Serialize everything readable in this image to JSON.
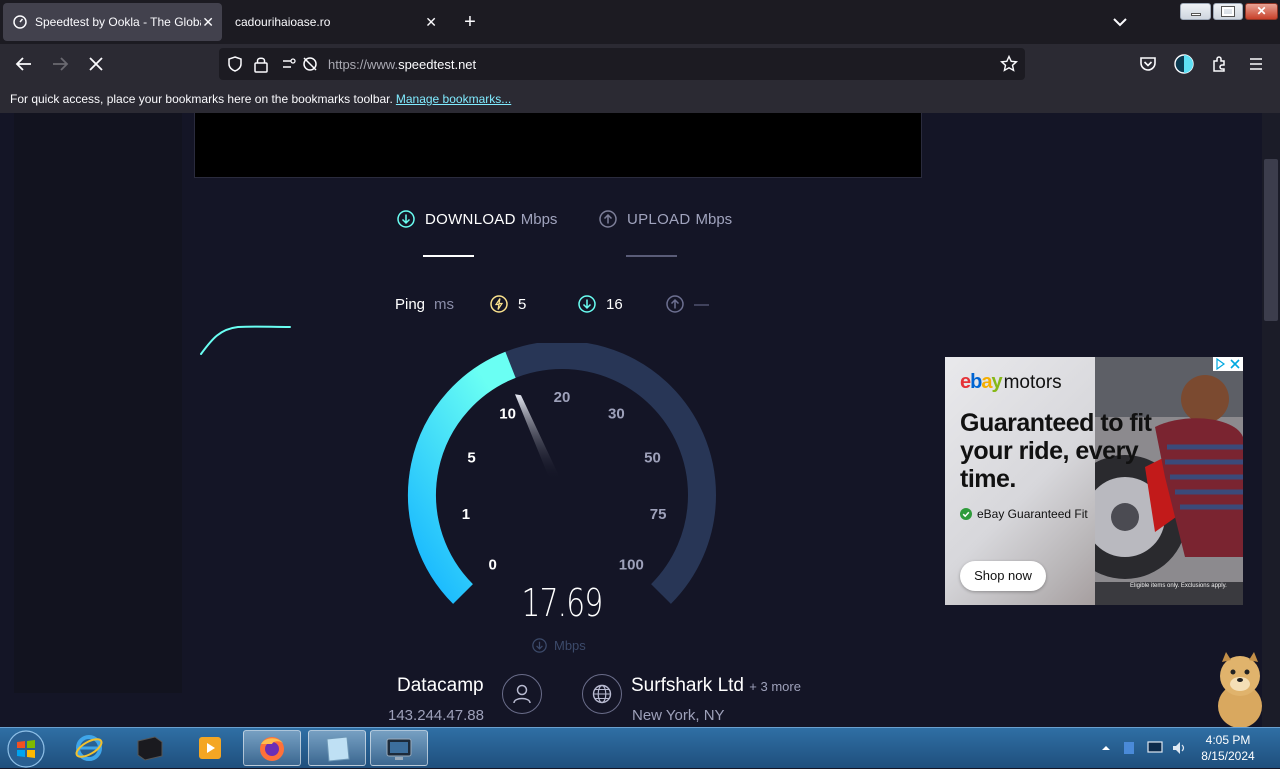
{
  "browser": {
    "tabs": [
      {
        "title": "Speedtest by Ookla - The Global",
        "active": true
      },
      {
        "title": "cadourihaioase.ro",
        "active": false
      }
    ],
    "url_scheme": "https://www.",
    "url_host": "speedtest.net",
    "bookmarks_message": "For quick access, place your bookmarks here on the bookmarks toolbar.",
    "bookmarks_link": "Manage bookmarks..."
  },
  "speedtest": {
    "download_label": "DOWNLOAD",
    "upload_label": "UPLOAD",
    "unit": "Mbps",
    "ping_label": "Ping",
    "ping_unit": "ms",
    "ping_idle": "5",
    "ping_download": "16",
    "ping_upload": "—",
    "gauge_ticks": [
      "0",
      "1",
      "5",
      "10",
      "20",
      "30",
      "50",
      "75",
      "100"
    ],
    "current_speed": "17.69",
    "speed_unit": "Mbps",
    "gauge_progress_percent": 42,
    "accent_download": "#6afff3",
    "accent_gauge_start": "#14b4ff",
    "provider_name": "Datacamp",
    "provider_ip": "143.244.47.88",
    "server_name": "Surfshark Ltd",
    "server_more": "+ 3 more",
    "server_location": "New York, NY"
  },
  "ad": {
    "brand_e": "e",
    "brand_b": "b",
    "brand_a": "a",
    "brand_y": "y",
    "brand_suffix": "motors",
    "headline": "Guaranteed to fit your ride, every time.",
    "badge": "eBay Guaranteed Fit",
    "cta": "Shop now",
    "fine_print": "Eligible items only. Exclusions apply."
  },
  "taskbar": {
    "time": "4:05 PM",
    "date": "8/15/2024"
  }
}
